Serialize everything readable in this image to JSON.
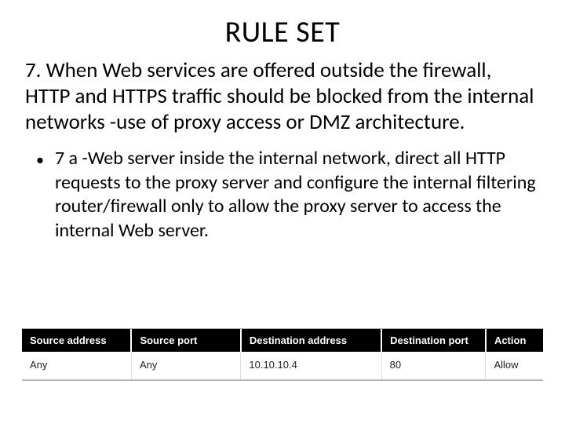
{
  "title": "RULE SET",
  "rule": "7. When Web services are offered outside the firewall, HTTP and HTTPS traffic should be blocked from the internal networks -use of proxy access or DMZ architecture.",
  "bullet": "7 a -Web server inside the internal network, direct all HTTP requests to the proxy server and configure the internal filtering router/firewall only to allow the proxy server to access the internal Web server.",
  "table": {
    "headers": [
      "Source address",
      "Source port",
      "Destination address",
      "Destination port",
      "Action"
    ],
    "row": [
      "Any",
      "Any",
      "10.10.10.4",
      "80",
      "Allow"
    ]
  }
}
